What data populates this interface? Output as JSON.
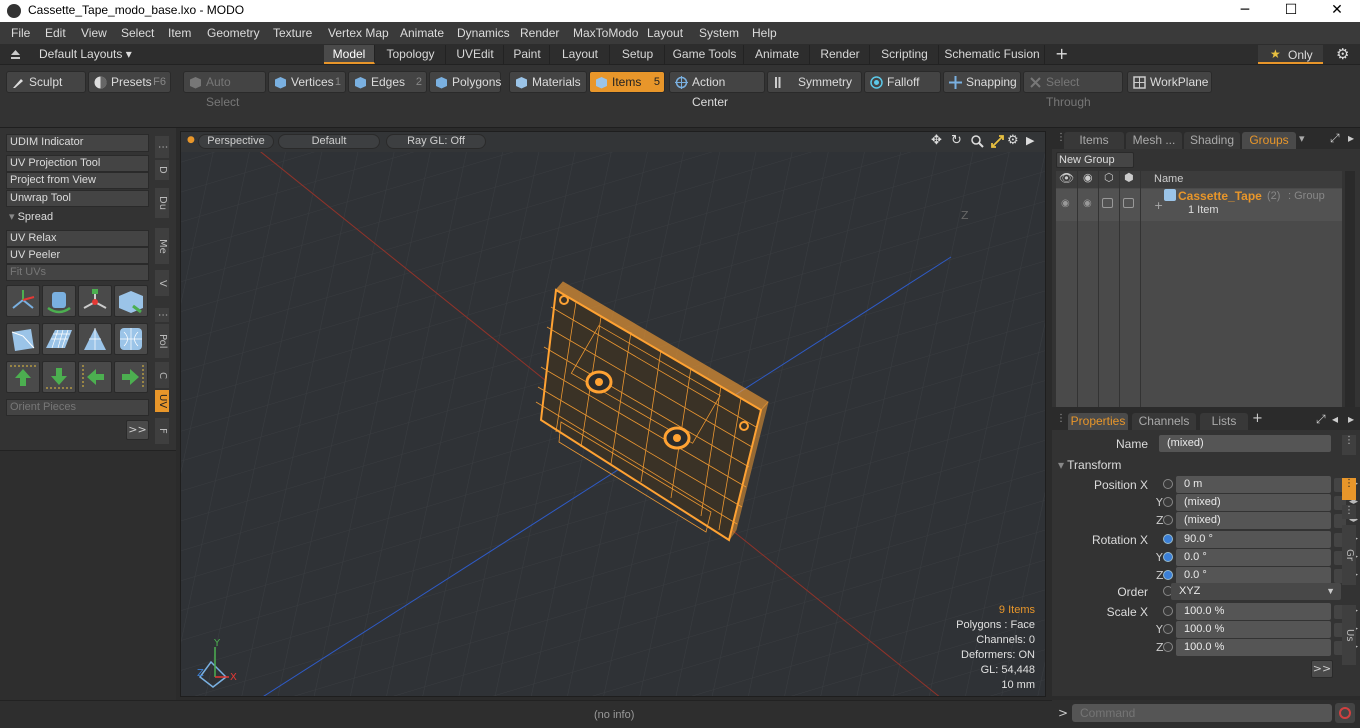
{
  "window": {
    "title": "Cassette_Tape_modo_base.lxo - MODO",
    "minimize": "─",
    "maximize": "☐",
    "close": "✕"
  },
  "menu": [
    "File",
    "Edit",
    "View",
    "Select",
    "Item",
    "Geometry",
    "Texture",
    "Vertex Map",
    "Animate",
    "Dynamics",
    "Render",
    "MaxToModo",
    "Layout",
    "System",
    "Help"
  ],
  "layouts": {
    "label": "Default Layouts ▾",
    "tabs": [
      "Model",
      "Topology",
      "UVEdit",
      "Paint",
      "Layout",
      "Setup",
      "Game Tools",
      "Animate",
      "Render",
      "Scripting",
      "Schematic Fusion"
    ],
    "active": "Model",
    "plus": "+",
    "only": "Only"
  },
  "toolbar": {
    "sculpt": "Sculpt",
    "presets": "Presets",
    "presets_key": "F6",
    "auto_select": "Auto Select",
    "vertices": "Vertices",
    "vertices_key": "1",
    "edges": "Edges",
    "edges_key": "2",
    "polygons": "Polygons",
    "materials": "Materials",
    "items": "Items",
    "items_key": "5",
    "action_center": "Action Center",
    "symmetry": "Symmetry",
    "falloff": "Falloff",
    "snapping": "Snapping",
    "select_through": "Select Through",
    "workplane": "WorkPlane"
  },
  "left_panel": {
    "udim": "UDIM Indicator",
    "uv_projection": "UV Projection Tool",
    "project_from_view": "Project from View",
    "unwrap": "Unwrap Tool",
    "spread": "Spread",
    "uv_relax": "UV Relax",
    "uv_peeler": "UV Peeler",
    "fit_uvs": "Fit UVs",
    "orient_pieces": "Orient Pieces",
    "more": ">>",
    "vtabs": [
      "D",
      "Du",
      "Me",
      "V",
      "Pol",
      "C",
      "UV",
      "F"
    ],
    "active_vtab": "UV"
  },
  "viewport": {
    "perspective": "Perspective",
    "default": "Default",
    "raygl": "Ray GL: Off",
    "info": {
      "items": "9 Items",
      "polygons": "Polygons : Face",
      "channels": "Channels: 0",
      "deformers": "Deformers: ON",
      "gl": "GL: 54,448",
      "scale": "10 mm"
    },
    "axis_y": "Y",
    "axis_x": "X",
    "axis_z": "Z",
    "z_marker": "Z"
  },
  "status": {
    "info": "(no info)"
  },
  "groups_panel": {
    "tabs": [
      "Items",
      "Mesh ...",
      "Shading",
      "Groups"
    ],
    "active": "Groups",
    "new_group": "New Group",
    "col_name": "Name",
    "group_name": "Cassette_Tape",
    "group_count": "(2)",
    "group_type": ": Group",
    "group_sub": "1 Item"
  },
  "properties_panel": {
    "tabs": [
      "Properties",
      "Channels",
      "Lists"
    ],
    "active": "Properties",
    "plus": "+",
    "name_label": "Name",
    "name_value": "(mixed)",
    "transform": "Transform",
    "position_label": "Position",
    "rotation_label": "Rotation",
    "order_label": "Order",
    "scale_label": "Scale",
    "axes": [
      "X",
      "Y",
      "Z"
    ],
    "position": [
      "0 m",
      "(mixed)",
      "(mixed)"
    ],
    "rotation": [
      "90.0 °",
      "0.0 °",
      "0.0 °"
    ],
    "order": "XYZ",
    "scale": [
      "100.0 %",
      "100.0 %",
      "100.0 %"
    ],
    "more": ">>",
    "side_tabs": [
      "Gr",
      "Us"
    ]
  },
  "command": {
    "prompt": ">",
    "placeholder": "Command"
  },
  "colors": {
    "accent": "#e8962a",
    "wire": "#ffa233",
    "x_axis": "#c0392b",
    "z_axis": "#2e5fd6"
  }
}
